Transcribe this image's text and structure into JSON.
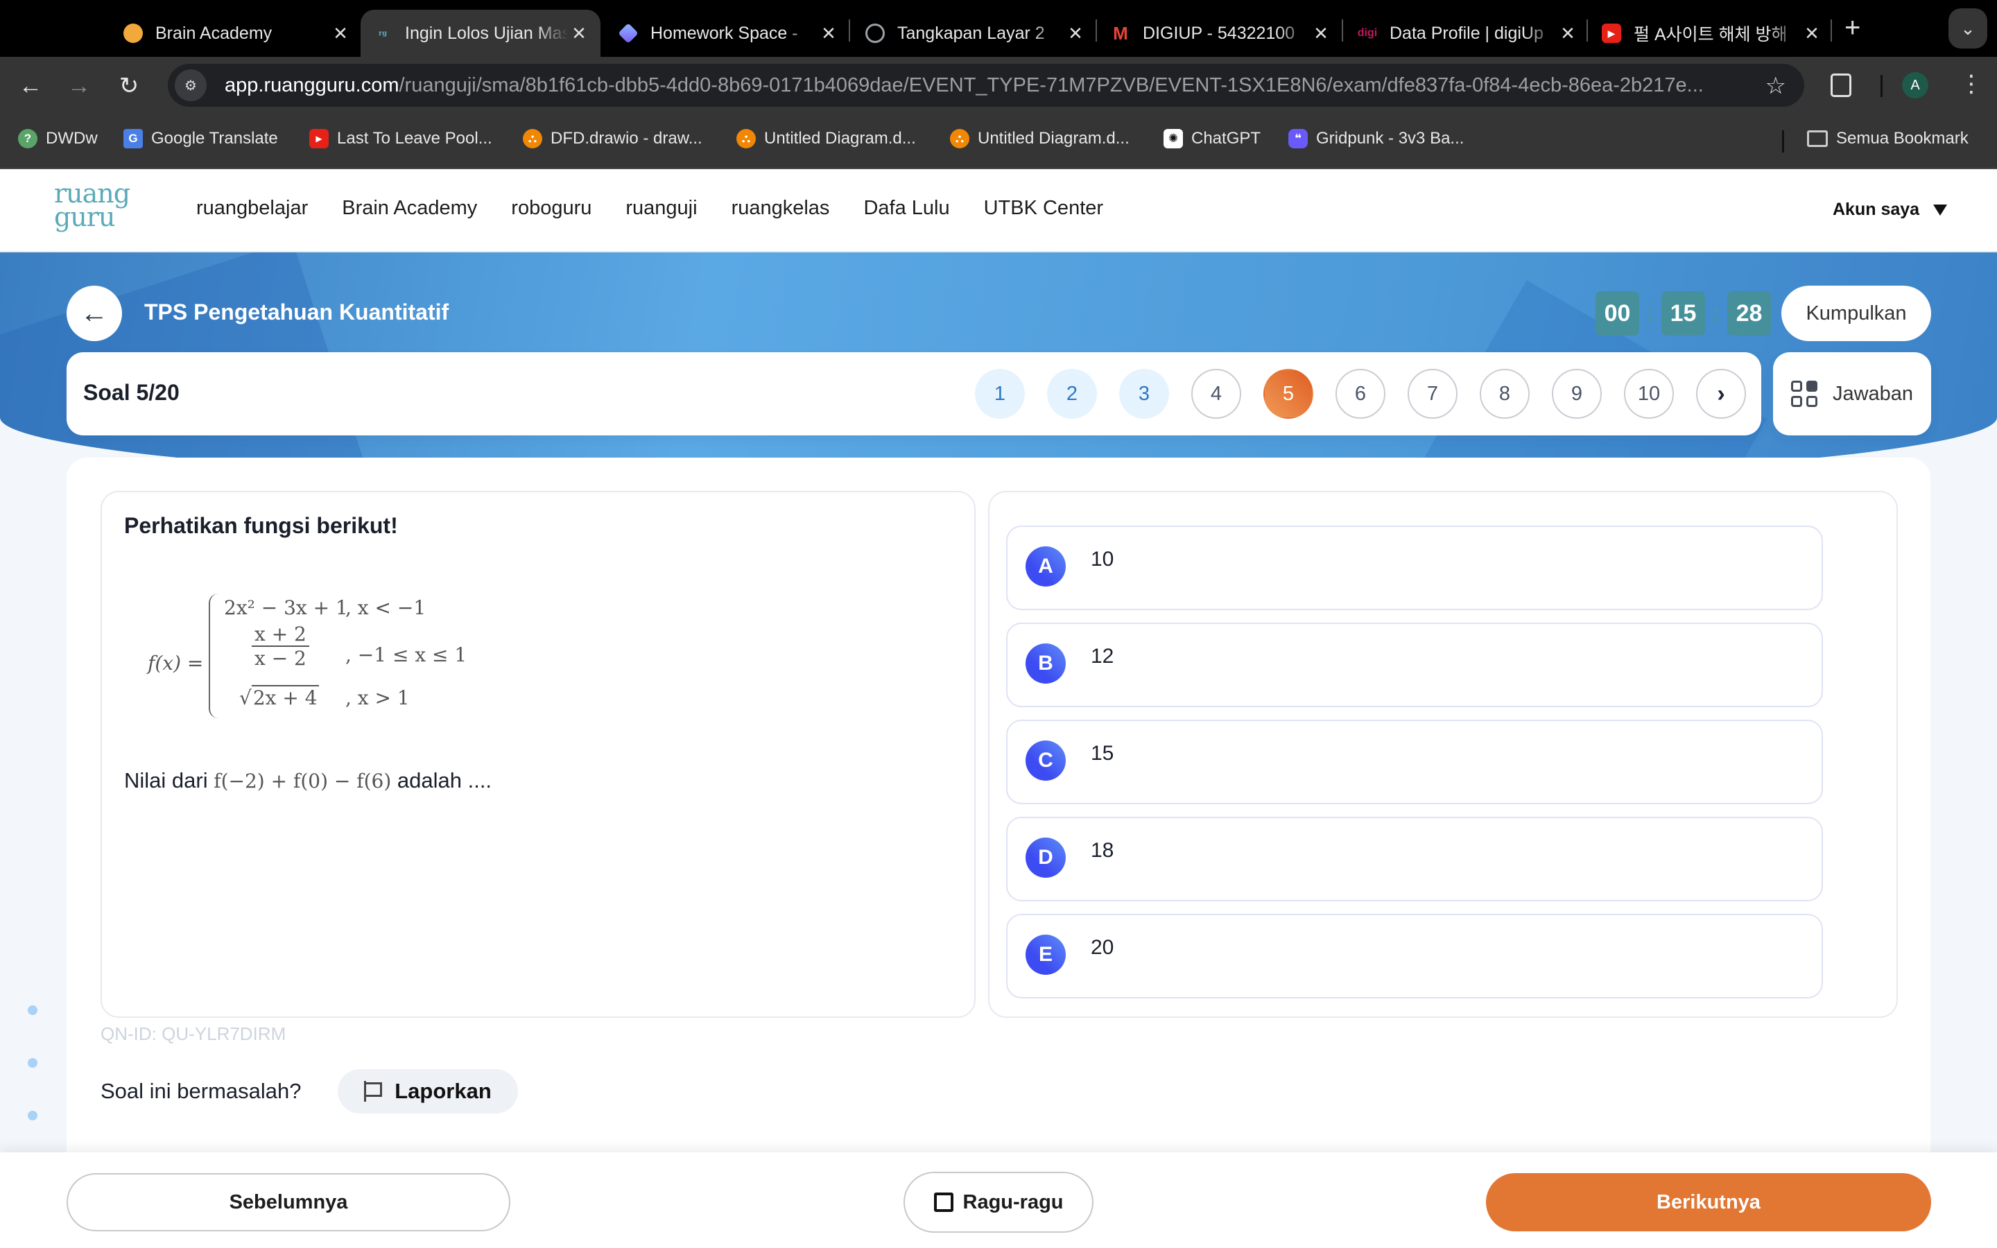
{
  "browser": {
    "tabs": [
      {
        "title": "Brain Academy",
        "icon": "brain-academy-favicon",
        "icon_color": "#f2a93b",
        "active": false
      },
      {
        "title": "Ingin Lolos Ujian Masuk",
        "icon": "ruangguru-favicon",
        "icon_color": "#5aaab8",
        "active": true
      },
      {
        "title": "Homework Space -",
        "icon": "homework-space-favicon",
        "icon_color": "#7b6cf6",
        "active": false
      },
      {
        "title": "Tangkapan Layar 2",
        "icon": "globe-favicon",
        "icon_color": "#9aa0a6",
        "active": false
      },
      {
        "title": "DIGIUP - 54322100",
        "icon": "gmail-favicon",
        "icon_color": "#ea4335",
        "active": false
      },
      {
        "title": "Data Profile | digiUp",
        "icon": "digi-favicon",
        "icon_color": "#c2185b",
        "active": false
      },
      {
        "title": "펄 A사이트 해체 방해",
        "icon": "youtube-favicon",
        "icon_color": "#e62117",
        "active": false
      }
    ],
    "close_glyph": "✕",
    "new_tab_glyph": "+",
    "tab_list_glyph": "⌄",
    "url_host": "app.ruangguru.com",
    "url_path": "/ruanguji/sma/8b1f61cb-dbb5-4dd0-8b69-0171b4069dae/EVENT_TYPE-71M7PZVB/EVENT-1SX1E8N6/exam/dfe837fa-0f84-4ecb-86ea-2b217e...",
    "profile_initial": "A",
    "bookmarks": [
      {
        "label": "DWDw",
        "icon_color": "#5aa469",
        "glyph": "?"
      },
      {
        "label": "Google Translate",
        "icon_color": "#4a7fe6",
        "glyph": "G"
      },
      {
        "label": "Last To Leave Pool...",
        "icon_color": "#e62117",
        "glyph": "▶"
      },
      {
        "label": "DFD.drawio - draw...",
        "icon_color": "#f08705",
        "glyph": "⛬"
      },
      {
        "label": "Untitled Diagram.d...",
        "icon_color": "#f08705",
        "glyph": "⛬"
      },
      {
        "label": "Untitled Diagram.d...",
        "icon_color": "#f08705",
        "glyph": "⛬"
      },
      {
        "label": "ChatGPT",
        "icon_color": "#ffffff",
        "glyph": "✺"
      },
      {
        "label": "Gridpunk - 3v3 Ba...",
        "icon_color": "#6a5af9",
        "glyph": "❝"
      }
    ],
    "all_bookmarks_label": "Semua Bookmark"
  },
  "site": {
    "logo_top": "ruang",
    "logo_bottom": "guru",
    "nav": [
      "ruangbelajar",
      "Brain Academy",
      "roboguru",
      "ruanguji",
      "ruangkelas",
      "Dafa Lulu",
      "UTBK Center"
    ],
    "account_label": "Akun saya"
  },
  "exam": {
    "title": "TPS Pengetahuan Kuantitatif",
    "timer": {
      "hours": "00",
      "minutes": "15",
      "seconds": "28"
    },
    "submit_label": "Kumpulkan",
    "question_counter": "Soal 5/20",
    "question_numbers": [
      {
        "n": "1",
        "state": "answered"
      },
      {
        "n": "2",
        "state": "answered"
      },
      {
        "n": "3",
        "state": "answered"
      },
      {
        "n": "4",
        "state": "unanswered"
      },
      {
        "n": "5",
        "state": "current"
      },
      {
        "n": "6",
        "state": "unanswered"
      },
      {
        "n": "7",
        "state": "unanswered"
      },
      {
        "n": "8",
        "state": "unanswered"
      },
      {
        "n": "9",
        "state": "unanswered"
      },
      {
        "n": "10",
        "state": "unanswered"
      }
    ],
    "next_page_glyph": "›",
    "answers_label": "Jawaban",
    "colors": {
      "current": "#e27633",
      "answered_bg": "#e5f3fe",
      "answered_text": "#2f78c4",
      "option_badge": "#3d4cf2",
      "timer_bg": "#45909a"
    }
  },
  "question": {
    "heading": "Perhatikan fungsi berikut!",
    "formula": {
      "lhs": "f(x) =",
      "case1_expr": "2x² − 3x + 1",
      "case1_cond": ", x < −1",
      "case2_num": "x + 2",
      "case2_den": "x − 2",
      "case2_cond": ", −1 ≤ x ≤ 1",
      "case3_radical": "√",
      "case3_expr": "2x + 4",
      "case3_cond": ", x > 1"
    },
    "prompt_before": "Nilai dari ",
    "prompt_math": "f(−2) + f(0) − f(6)",
    "prompt_after": " adalah ....",
    "options": [
      {
        "letter": "A",
        "text": "10"
      },
      {
        "letter": "B",
        "text": "12"
      },
      {
        "letter": "C",
        "text": "15"
      },
      {
        "letter": "D",
        "text": "18"
      },
      {
        "letter": "E",
        "text": "20"
      }
    ],
    "qn_id": "QN-ID: QU-YLR7DIRM",
    "report_question": "Soal ini bermasalah?",
    "report_label": "Laporkan"
  },
  "footer": {
    "prev_label": "Sebelumnya",
    "doubt_label": "Ragu-ragu",
    "next_label": "Berikutnya"
  }
}
